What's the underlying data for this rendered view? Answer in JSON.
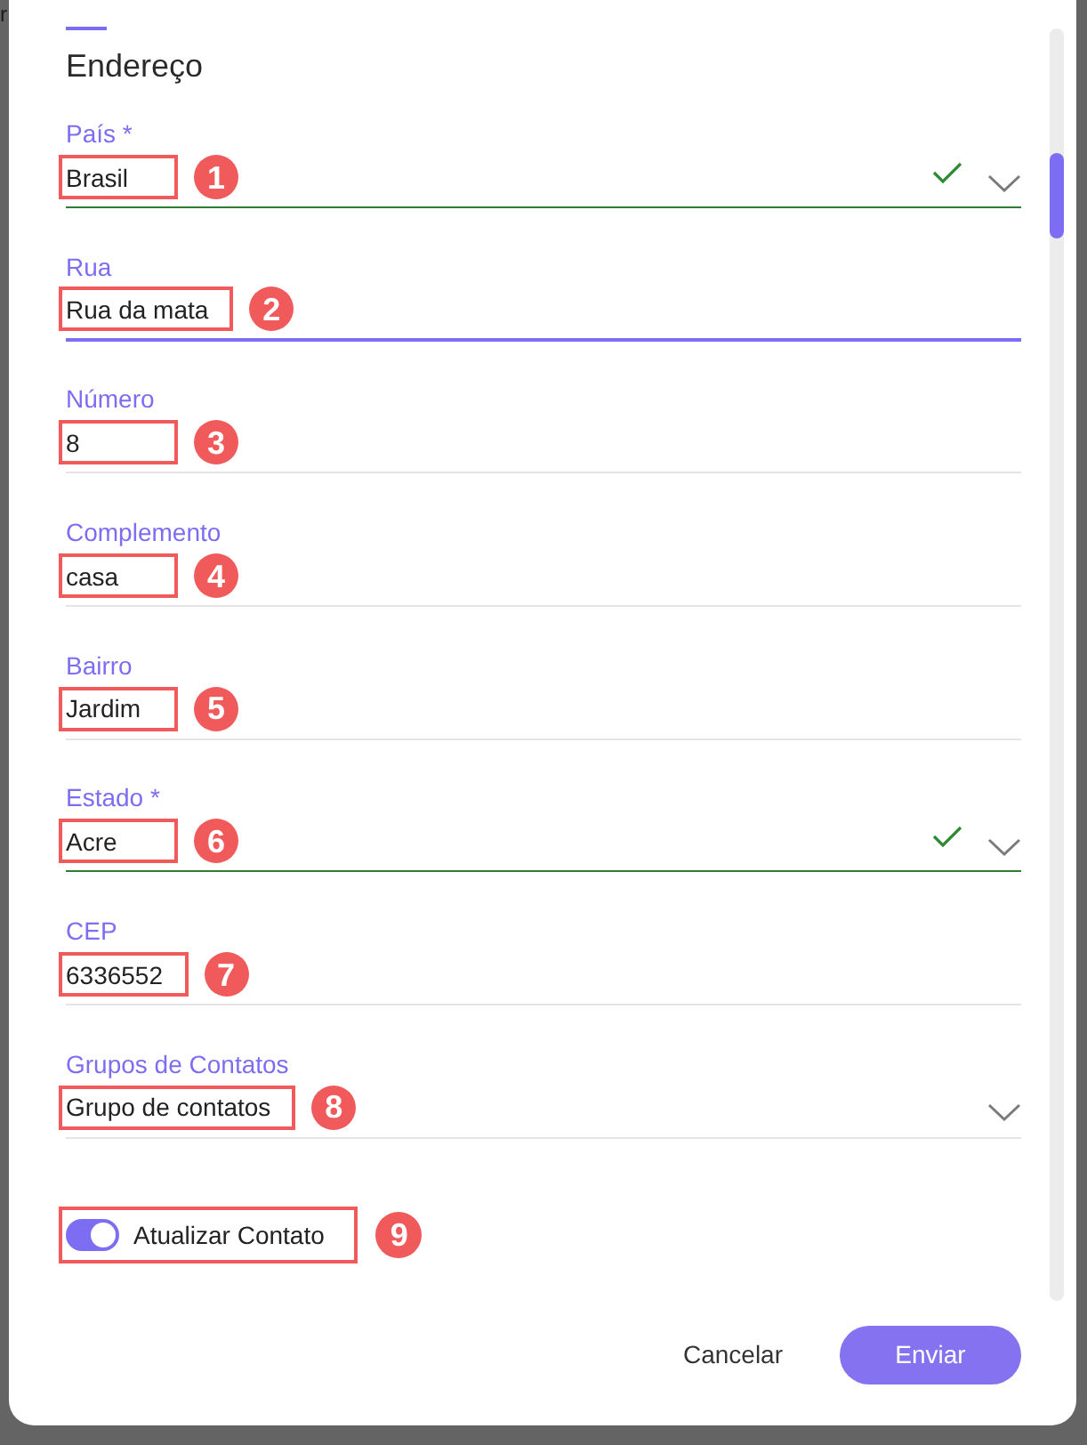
{
  "backdrop_text": "r",
  "section": {
    "title": "Endereço"
  },
  "fields": [
    {
      "kind": "select",
      "label": "País *",
      "value": "Brasil",
      "valid": true,
      "focused": false,
      "annotation": "1"
    },
    {
      "kind": "text",
      "label": "Rua",
      "value": "Rua da mata",
      "valid": false,
      "focused": true,
      "annotation": "2"
    },
    {
      "kind": "text",
      "label": "Número",
      "value": "8",
      "valid": false,
      "focused": false,
      "annotation": "3"
    },
    {
      "kind": "text",
      "label": "Complemento",
      "value": "casa",
      "valid": false,
      "focused": false,
      "annotation": "4"
    },
    {
      "kind": "text",
      "label": "Bairro",
      "value": "Jardim",
      "valid": false,
      "focused": false,
      "annotation": "5"
    },
    {
      "kind": "select",
      "label": "Estado *",
      "value": "Acre",
      "valid": true,
      "focused": false,
      "annotation": "6"
    },
    {
      "kind": "text",
      "label": "CEP",
      "value": "6336552",
      "valid": false,
      "focused": false,
      "annotation": "7"
    },
    {
      "kind": "select",
      "label": "Grupos de Contatos",
      "value": "Grupo de contatos",
      "valid": false,
      "focused": false,
      "annotation": "8"
    }
  ],
  "toggle": {
    "label": "Atualizar Contato",
    "on": true,
    "annotation": "9"
  },
  "buttons": [
    {
      "kind": "text",
      "label": "Cancelar"
    },
    {
      "kind": "primary",
      "label": "Enviar"
    }
  ]
}
